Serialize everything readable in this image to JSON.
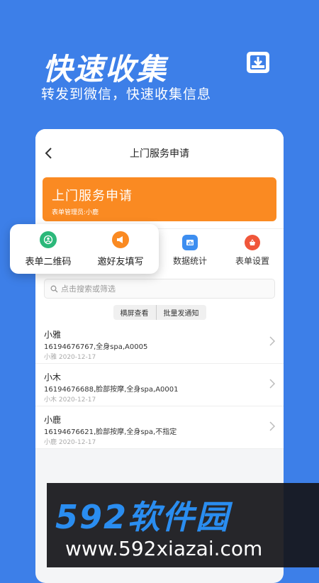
{
  "hero": {
    "title": "快速收集",
    "subtitle": "转发到微信，快速收集信息",
    "icon": "download-tray-icon"
  },
  "nav": {
    "title": "上门服务申请",
    "back_icon": "chevron-left-icon"
  },
  "banner": {
    "title": "上门服务申请",
    "subtitle": "表单管理员:小鹿",
    "color": "#fa8a22"
  },
  "actions": [
    {
      "label": "数据统计",
      "icon": "stats-icon",
      "color": "#3d8ef0"
    },
    {
      "label": "表单设置",
      "icon": "settings-basket-icon",
      "color": "#f0563a"
    }
  ],
  "popup": [
    {
      "label": "表单二维码",
      "icon": "qrcode-user-icon",
      "color": "#2cb87a"
    },
    {
      "label": "邀好友填写",
      "icon": "megaphone-icon",
      "color": "#fa8a22"
    }
  ],
  "search": {
    "placeholder": "点击搜索或筛选"
  },
  "toolbar": {
    "landscape": "横屏查看",
    "notify": "批量发通知"
  },
  "entries": [
    {
      "name": "小雅",
      "detail": "16194676767,全身spa,A0005",
      "meta": "小雅 2020-12-17"
    },
    {
      "name": "小木",
      "detail": "16194676688,脸部按摩,全身spa,A0001",
      "meta": "小木 2020-12-17"
    },
    {
      "name": "小鹿",
      "detail": "16194676621,脸部按摩,全身spa,不指定",
      "meta": "小鹿 2020-12-17"
    }
  ],
  "watermark": {
    "brand": "592软件园",
    "url": "www.592xiazai.com"
  },
  "colors": {
    "background": "#3d7fe8",
    "accent": "#fa8a22"
  }
}
